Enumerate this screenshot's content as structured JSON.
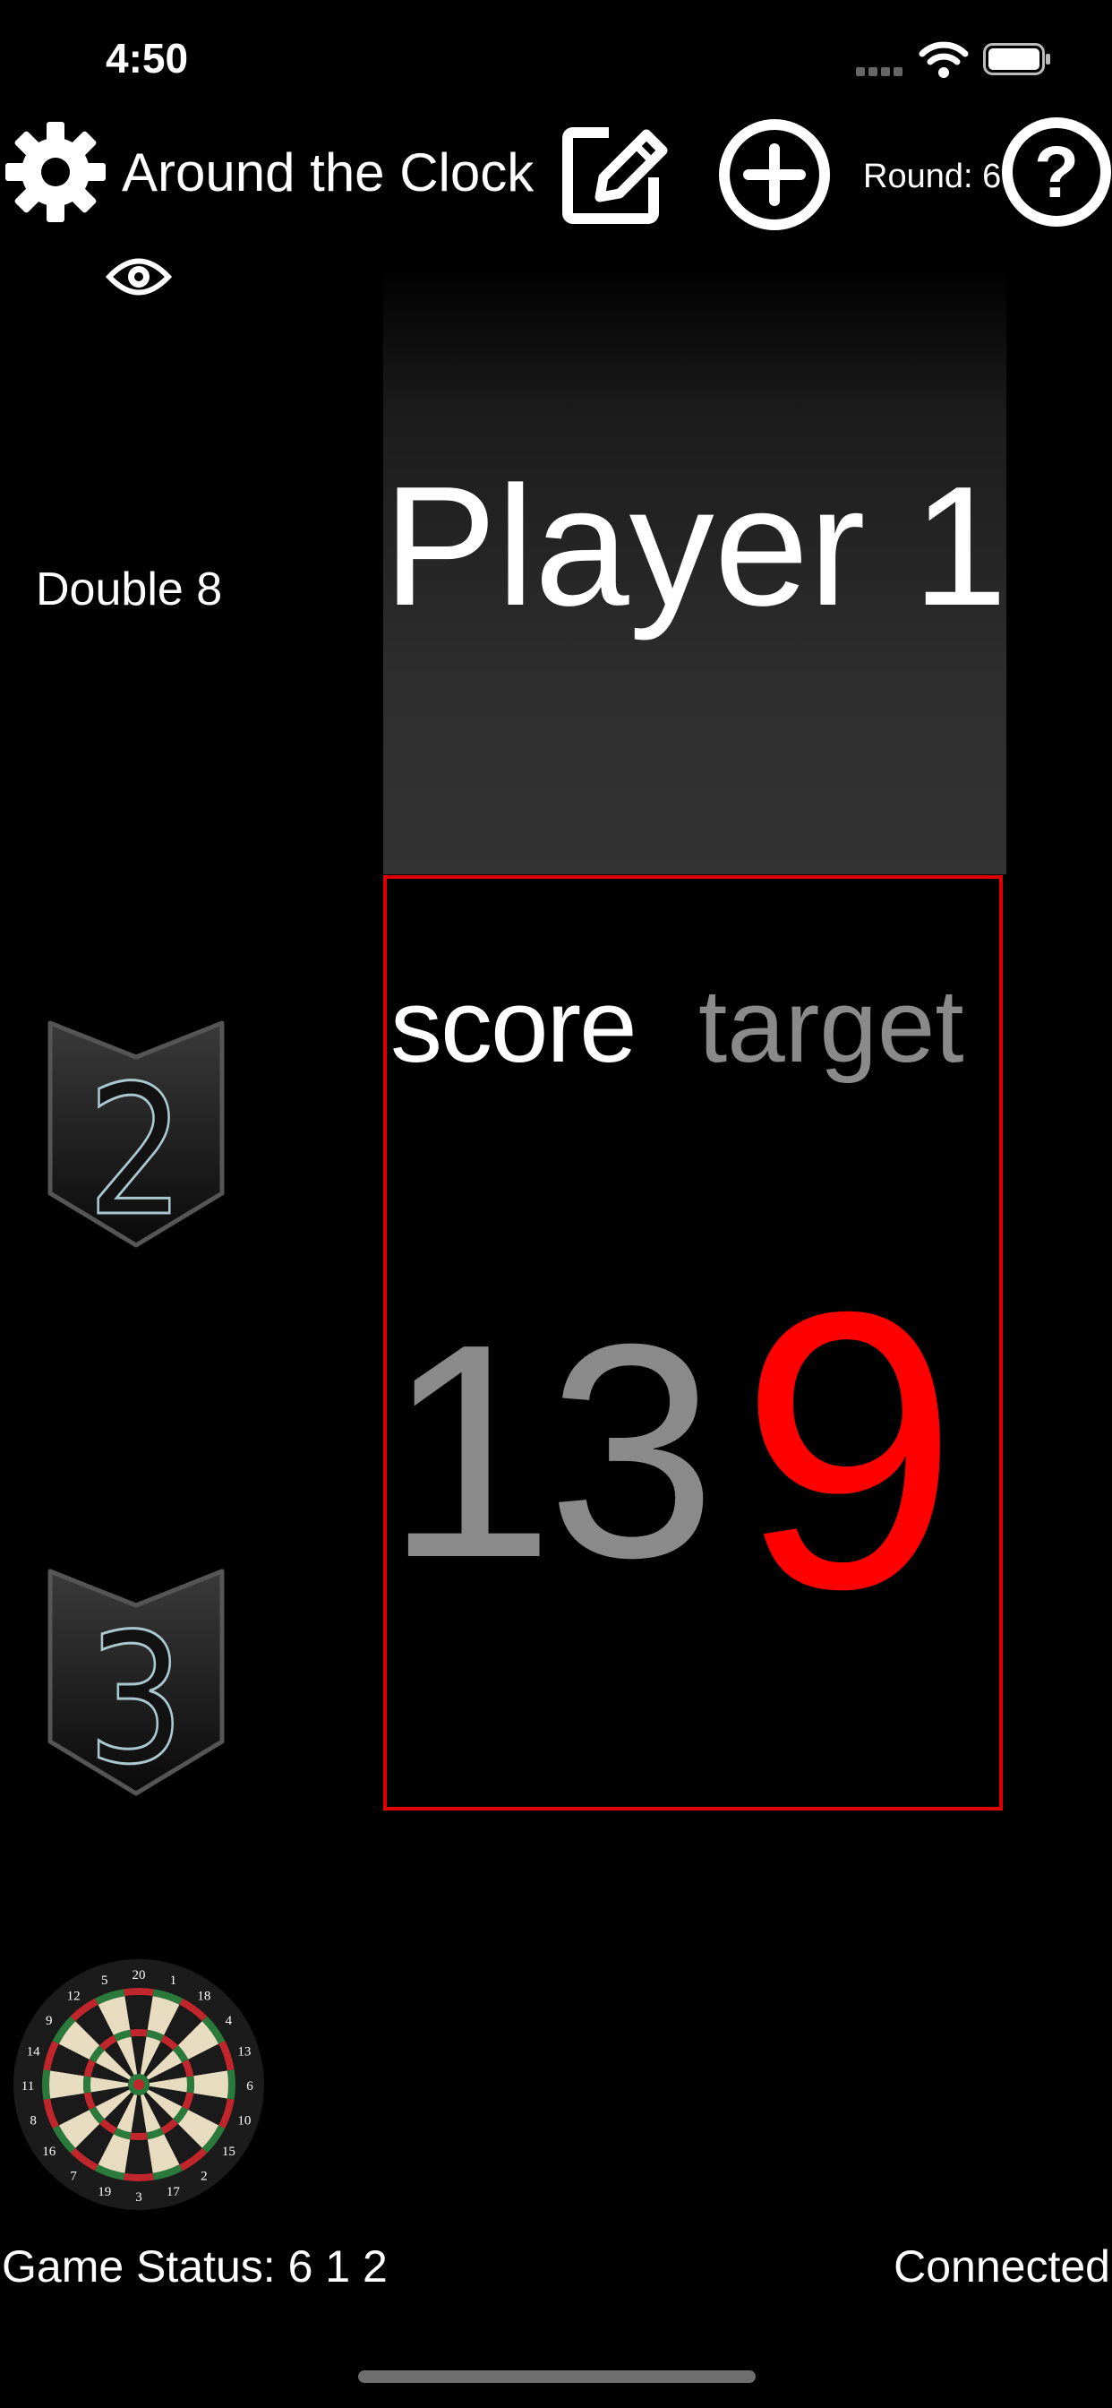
{
  "status_bar": {
    "time": "4:50"
  },
  "toolbar": {
    "title": "Around the Clock",
    "round_label": "Round: 6"
  },
  "side": {
    "double_label": "Double 8",
    "badges": [
      {
        "number": "2"
      },
      {
        "number": "3"
      }
    ]
  },
  "player": {
    "name": "Player 1"
  },
  "scoreboard": {
    "score_label": "score",
    "target_label": "target",
    "score_value": "13",
    "target_value": "9"
  },
  "footer": {
    "game_status": "Game Status: 6 1 2",
    "connection": "Connected"
  },
  "dartboard_numbers": [
    "20",
    "1",
    "18",
    "4",
    "13",
    "6",
    "10",
    "15",
    "2",
    "17",
    "3",
    "19",
    "7",
    "16",
    "8",
    "11",
    "14",
    "9",
    "12",
    "5"
  ],
  "colors": {
    "background": "#000000",
    "accent_red": "#ff0000",
    "score_border": "#e00000",
    "muted_gray": "#8a8a8a"
  },
  "icons": {
    "settings": "gear-icon",
    "edit": "pencil-square-icon",
    "add": "plus-circle-icon",
    "help": "question-circle-icon",
    "view": "eye-icon"
  }
}
